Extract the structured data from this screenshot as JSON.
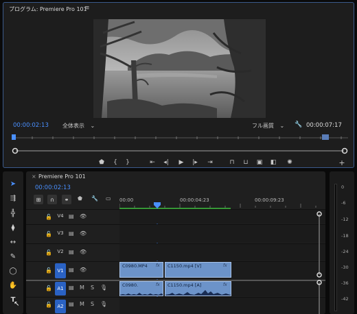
{
  "program_monitor": {
    "title": "プログラム: Premiere Pro 101",
    "menu_glyph": "≡",
    "current_timecode": "00:00:02:13",
    "zoom_option": "全体表示",
    "quality_option": "フル画質",
    "duration_timecode": "00:00:07:17",
    "playhead_fraction": 0.0
  },
  "tools": {
    "items": [
      "select",
      "track-select-forward",
      "ripple-edit",
      "razor",
      "slip",
      "pen",
      "ellipse",
      "hand",
      "type"
    ]
  },
  "timeline": {
    "close_glyph": "×",
    "title": "Premiere Pro 101",
    "current_timecode": "00:00:02:13",
    "ruler": [
      "00:00",
      "00:00:04:23",
      "00:00:09:23"
    ],
    "tracks": [
      {
        "name": "V4",
        "kind": "video"
      },
      {
        "name": "V3",
        "kind": "video"
      },
      {
        "name": "V2",
        "kind": "video"
      },
      {
        "name": "V1",
        "kind": "video"
      },
      {
        "name": "A1",
        "kind": "audio"
      },
      {
        "name": "A2",
        "kind": "audio"
      }
    ],
    "clips": {
      "v1_a": "C0980.MP4",
      "v1_b": "C1150.mp4 [V]",
      "a1_a": "C0980.",
      "a1_b": "C1150.mp4 [A]"
    },
    "track_letters": {
      "mute": "M",
      "solo": "S"
    }
  },
  "audio_meter": {
    "labels": [
      "0",
      "-6",
      "-12",
      "-18",
      "-24",
      "-30",
      "-36",
      "-42"
    ]
  }
}
